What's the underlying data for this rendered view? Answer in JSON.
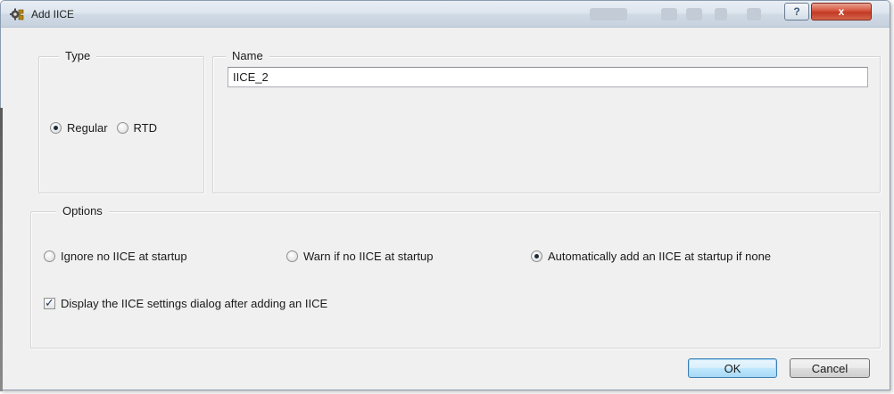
{
  "window": {
    "title": "Add IICE",
    "icon": "gear-puzzle-icon",
    "help_label": "?",
    "close_label": "x"
  },
  "type_group": {
    "legend": "Type",
    "options": [
      {
        "label": "Regular",
        "checked": true
      },
      {
        "label": "RTD",
        "checked": false
      }
    ]
  },
  "name_group": {
    "legend": "Name",
    "value": "IICE_2"
  },
  "options_group": {
    "legend": "Options",
    "radios": [
      {
        "label": "Ignore no IICE at startup",
        "checked": false
      },
      {
        "label": "Warn if no IICE at startup",
        "checked": false
      },
      {
        "label": "Automatically add an IICE at startup if none",
        "checked": true
      }
    ],
    "checkbox": {
      "label": "Display the IICE settings dialog after adding an IICE",
      "checked": true
    }
  },
  "buttons": {
    "ok_label": "OK",
    "cancel_label": "Cancel"
  },
  "colors": {
    "close_button": "#c94a33",
    "titlebar": "#dde5ee",
    "dialog_bg": "#f0f0f0",
    "default_button": "#bee6fd"
  }
}
